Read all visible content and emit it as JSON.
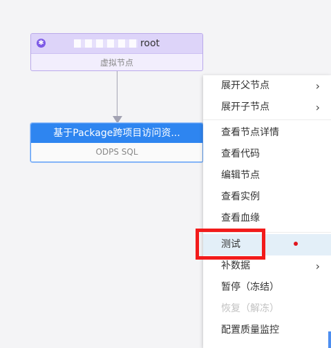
{
  "canvas": {
    "root_node": {
      "title": "root",
      "subtitle": "虚拟节点",
      "icon": "asterisk-icon"
    },
    "sql_node": {
      "title": "基于Package跨项目访问资...",
      "subtitle": "ODPS SQL"
    }
  },
  "context_menu": {
    "items": [
      {
        "label": "展开父节点",
        "submenu": true
      },
      {
        "label": "展开子节点",
        "submenu": true
      },
      {
        "label": "查看节点详情"
      },
      {
        "label": "查看代码"
      },
      {
        "label": "编辑节点"
      },
      {
        "label": "查看实例"
      },
      {
        "label": "查看血缘"
      },
      {
        "label": "测试",
        "hovered": true
      },
      {
        "label": "补数据",
        "submenu": true
      },
      {
        "label": "暂停（冻结）"
      },
      {
        "label": "恢复（解冻）",
        "disabled": true
      },
      {
        "label": "配置质量监控"
      }
    ],
    "chevron": "›"
  },
  "colors": {
    "virtual_node_accent": "#7d5ae6",
    "sql_node_header": "#2e85f0",
    "highlight_box": "#f21b1b",
    "hover_row": "#e3eff8"
  }
}
